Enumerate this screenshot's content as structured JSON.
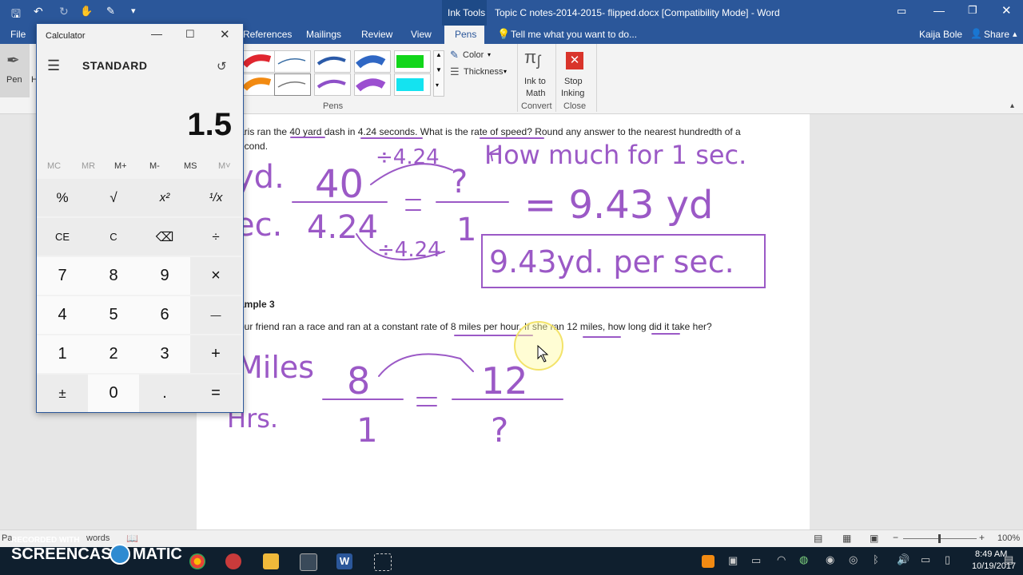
{
  "word": {
    "quick_access": [
      "save-icon",
      "undo-icon",
      "redo-icon",
      "touch-mode-icon",
      "ink-icon",
      "customize-icon"
    ],
    "contextual_tab_group": "Ink Tools",
    "title": "Topic C notes-2014-2015- flipped.docx [Compatibility Mode] - Word",
    "file_tab": "File",
    "tabs": [
      "References",
      "Mailings",
      "Review",
      "View",
      "Pens"
    ],
    "active_tab": "Pens",
    "tell_me": "Tell me what you want to do...",
    "user": "Kaija Bole",
    "share": "Share",
    "left_tool_label": "Pen",
    "left_tool_label2": "H",
    "color_label": "Color",
    "thickness_label": "Thickness",
    "pens_group_label": "Pens",
    "ink_to_math": [
      "Ink to",
      "Math"
    ],
    "convert_group_label": "Convert",
    "stop_inking": [
      "Stop",
      "Inking"
    ],
    "close_group_label": "Close"
  },
  "document": {
    "q_line1": "aris ran the 40 yard dash in 4.24 seconds. What is the rate of speed? Round any answer to the nearest hundredth of a",
    "q_line2": "econd.",
    "example_heading": "ample 3",
    "q2_line": "our friend ran a race and ran at a constant rate of 8 miles per hour. If she ran 12 miles, how long did it take her?",
    "ink": {
      "how_much": "How much for 1 sec.",
      "div_top": "÷4.24",
      "div_bot": "÷4.24",
      "yd_label": "yd.",
      "sec_label": "ec.",
      "num_top": "40",
      "num_bot": "4.24",
      "q_top": "?",
      "q_bot": "1",
      "result": "= 9.43 yd",
      "boxed": "9.43yd. per sec.",
      "miles_label": "Miles",
      "hrs_label": "Hrs.",
      "m_top": "8",
      "m_bot": "1",
      "m2_top": "12",
      "m2_bot": "?"
    },
    "ink_color": "#9b59c6"
  },
  "statusbar": {
    "left": "Pa",
    "words": "words",
    "zoom": "100%"
  },
  "calculator": {
    "title": "Calculator",
    "mode": "STANDARD",
    "display": "1.5",
    "memory": [
      "MC",
      "MR",
      "M+",
      "M-",
      "MS",
      "M˅"
    ],
    "keys": [
      [
        "%",
        "√",
        "x²",
        "¹/x"
      ],
      [
        "CE",
        "C",
        "⌫",
        "÷"
      ],
      [
        "7",
        "8",
        "9",
        "×"
      ],
      [
        "4",
        "5",
        "6",
        "—"
      ],
      [
        "1",
        "2",
        "3",
        "+"
      ],
      [
        "±",
        "0",
        ".",
        "="
      ]
    ]
  },
  "taskbar": {
    "watermark_top": "RECORDED WITH",
    "watermark_main": "SCREENCAST",
    "watermark_tail": "MATIC",
    "time": "8:49 AM",
    "date": "10/19/2017"
  }
}
